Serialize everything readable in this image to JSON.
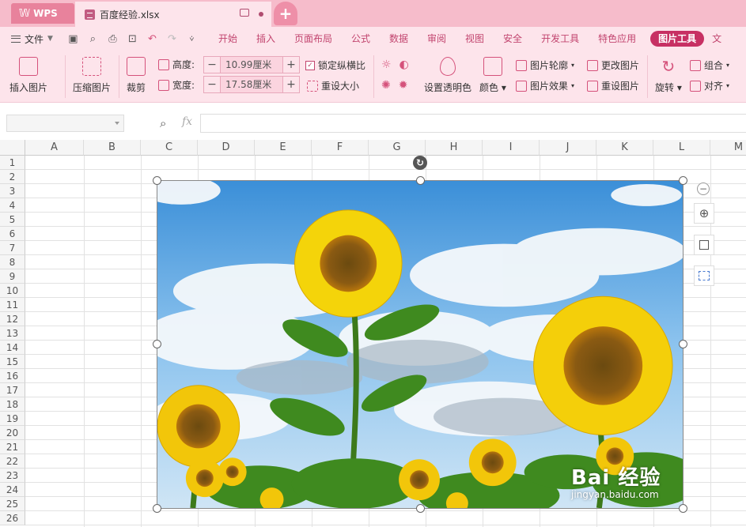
{
  "titlebar": {
    "app_name": "WPS",
    "doc_tab_title": "百度经验.xlsx",
    "new_tab_symbol": "+"
  },
  "menubar": {
    "file_label": "文件",
    "items": [
      "开始",
      "插入",
      "页面布局",
      "公式",
      "数据",
      "审阅",
      "视图",
      "安全",
      "开发工具",
      "特色应用"
    ],
    "active_item": "图片工具",
    "overflow": "文"
  },
  "ribbon": {
    "insert_picture": "插入图片",
    "compress_picture": "压缩图片",
    "crop": "裁剪",
    "height_label": "高度:",
    "height_value": "10.99厘米",
    "width_label": "宽度:",
    "width_value": "17.58厘米",
    "lock_ratio": "锁定纵横比",
    "reset_size": "重设大小",
    "set_transparent": "设置透明色",
    "color": "颜色",
    "picture_outline": "图片轮廓",
    "picture_effect": "图片效果",
    "change_picture": "更改图片",
    "reset_picture": "重设图片",
    "rotate": "旋转",
    "group": "组合",
    "align": "对齐"
  },
  "formulabar": {
    "fx": "fx",
    "value": ""
  },
  "grid": {
    "columns": [
      "A",
      "B",
      "C",
      "D",
      "E",
      "F",
      "G",
      "H",
      "I",
      "J",
      "K",
      "L",
      "M"
    ],
    "rows": [
      "1",
      "2",
      "3",
      "4",
      "5",
      "6",
      "7",
      "8",
      "9",
      "10",
      "11",
      "12",
      "13",
      "14",
      "15",
      "16",
      "17",
      "18",
      "19",
      "20",
      "21",
      "22",
      "23",
      "24",
      "25",
      "26"
    ]
  },
  "picture": {
    "watermark_main": "Bai 经验",
    "watermark_sub": "jingyan.baidu.com"
  },
  "colors": {
    "accent": "#c73063",
    "titlebar": "#f6bccb",
    "ribbon": "#fde4eb"
  }
}
